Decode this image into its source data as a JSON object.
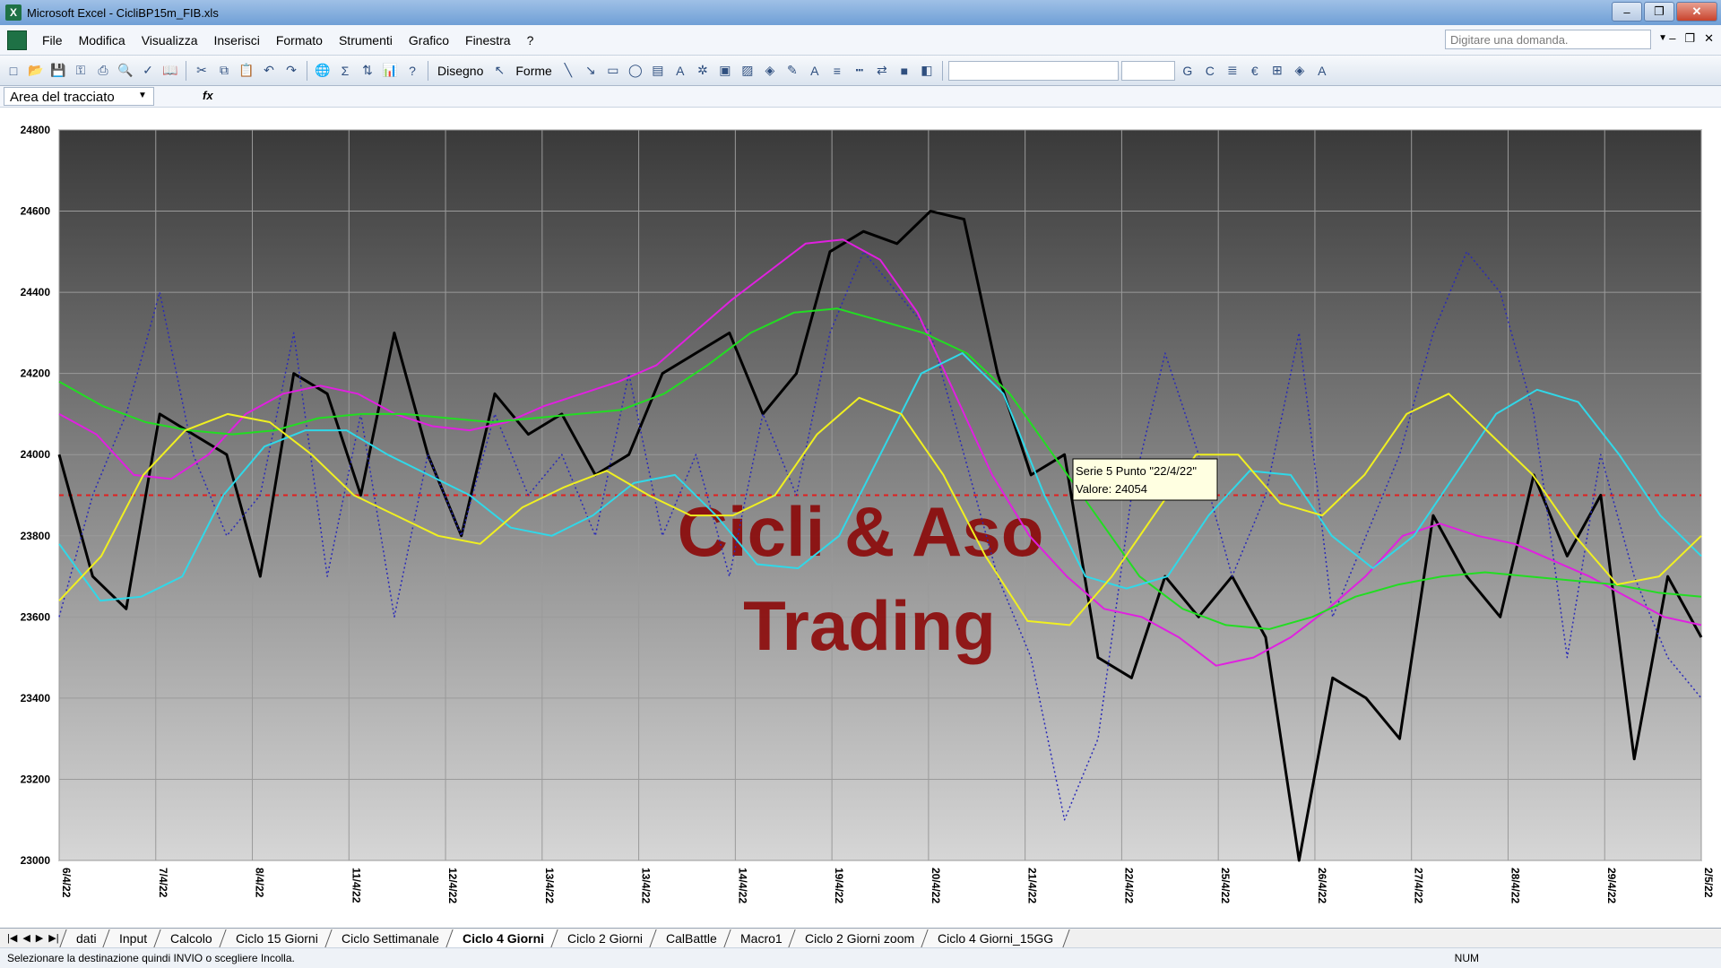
{
  "window": {
    "title": "Microsoft Excel - CicliBP15m_FIB.xls"
  },
  "menu": {
    "items": [
      "File",
      "Modifica",
      "Visualizza",
      "Inserisci",
      "Formato",
      "Strumenti",
      "Grafico",
      "Finestra",
      "?"
    ],
    "ask_placeholder": "Digitare una domanda."
  },
  "toolbar": {
    "disegno_label": "Disegno",
    "forme_label": "Forme"
  },
  "namebox": {
    "value": "Area del tracciato"
  },
  "sheet_tabs": {
    "items": [
      "dati",
      "Input",
      "Calcolo",
      "Ciclo 15 Giorni",
      "Ciclo Settimanale",
      "Ciclo 4 Giorni",
      "Ciclo 2 Giorni",
      "CalBattle",
      "Macro1",
      "Ciclo 2 Giorni zoom",
      "Ciclo 4 Giorni_15GG"
    ],
    "active": "Ciclo 4 Giorni"
  },
  "status": {
    "message": "Selezionare la destinazione quindi INVIO o scegliere Incolla.",
    "num": "NUM"
  },
  "chart_data": {
    "type": "line",
    "ylim": [
      23000,
      24800
    ],
    "yticks": [
      23000,
      23200,
      23400,
      23600,
      23800,
      24000,
      24200,
      24400,
      24600,
      24800
    ],
    "categories": [
      "6/4/22",
      "7/4/22",
      "8/4/22",
      "11/4/22",
      "12/4/22",
      "13/4/22",
      "13/4/22",
      "14/4/22",
      "19/4/22",
      "20/4/22",
      "21/4/22",
      "22/4/22",
      "25/4/22",
      "26/4/22",
      "27/4/22",
      "28/4/22",
      "29/4/22",
      "2/5/22"
    ],
    "reference_line": 23900,
    "watermark": [
      "Cicli & Aso",
      "Trading"
    ],
    "tooltip": {
      "line1": "Serie 5 Punto \"22/4/22\"",
      "line2": "Valore: 24054"
    },
    "colors": {
      "price": "#000000",
      "dotted": "#2a2ab8",
      "magenta": "#e020e0",
      "green": "#22dd22",
      "cyan": "#30d8e8",
      "yellow": "#f0f020",
      "reference": "#e02020",
      "watermark": "#8b0000"
    },
    "series": [
      {
        "color": "#000000",
        "values": [
          24000,
          23700,
          23620,
          24100,
          24050,
          24000,
          23700,
          24200,
          24150,
          23900,
          24300,
          24000,
          23800,
          24150,
          24050,
          24100,
          23950,
          24000,
          24200,
          24250,
          24300,
          24100,
          24200,
          24500,
          24550,
          24520,
          24600,
          24580,
          24200,
          23950,
          24000,
          23500,
          23450,
          23700,
          23600,
          23700,
          23550,
          23000,
          23450,
          23400,
          23300,
          23850,
          23700,
          23600,
          23950,
          23750,
          23900,
          23250,
          23700,
          23550
        ]
      },
      {
        "color": "#2a2ab8",
        "values": [
          23600,
          23900,
          24100,
          24400,
          24000,
          23800,
          23900,
          24300,
          23700,
          24100,
          23600,
          24000,
          23800,
          24100,
          23900,
          24000,
          23800,
          24200,
          23800,
          24000,
          23700,
          24100,
          23900,
          24300,
          24500,
          24400,
          24300,
          24000,
          23700,
          23500,
          23100,
          23300,
          23900,
          24250,
          24000,
          23700,
          23900,
          24300,
          23600,
          23800,
          24000,
          24300,
          24500,
          24400,
          24100,
          23500,
          24000,
          23700,
          23500,
          23400
        ]
      },
      {
        "color": "#e020e0",
        "values": [
          24100,
          24050,
          23950,
          23940,
          24000,
          24100,
          24150,
          24170,
          24150,
          24100,
          24070,
          24060,
          24080,
          24120,
          24150,
          24180,
          24220,
          24300,
          24380,
          24450,
          24520,
          24530,
          24480,
          24350,
          24150,
          23950,
          23800,
          23700,
          23620,
          23600,
          23550,
          23480,
          23500,
          23550,
          23620,
          23700,
          23800,
          23830,
          23800,
          23780,
          23740,
          23700,
          23650,
          23600,
          23580
        ]
      },
      {
        "color": "#22dd22",
        "values": [
          24180,
          24120,
          24080,
          24060,
          24050,
          24060,
          24090,
          24100,
          24100,
          24090,
          24080,
          24090,
          24100,
          24110,
          24150,
          24220,
          24300,
          24350,
          24360,
          24330,
          24300,
          24250,
          24150,
          24000,
          23850,
          23700,
          23620,
          23580,
          23570,
          23600,
          23650,
          23680,
          23700,
          23710,
          23700,
          23690,
          23680,
          23660,
          23650
        ]
      },
      {
        "color": "#30d8e8",
        "values": [
          23780,
          23640,
          23650,
          23700,
          23900,
          24020,
          24060,
          24060,
          24000,
          23950,
          23900,
          23820,
          23800,
          23850,
          23930,
          23950,
          23850,
          23730,
          23720,
          23800,
          24000,
          24200,
          24250,
          24150,
          23900,
          23700,
          23670,
          23700,
          23850,
          23960,
          23950,
          23800,
          23720,
          23800,
          23950,
          24100,
          24160,
          24130,
          24000,
          23850,
          23750
        ]
      },
      {
        "color": "#f0f020",
        "values": [
          23640,
          23750,
          23950,
          24060,
          24100,
          24080,
          24000,
          23900,
          23850,
          23800,
          23780,
          23870,
          23920,
          23960,
          23900,
          23850,
          23850,
          23900,
          24050,
          24140,
          24100,
          23950,
          23750,
          23590,
          23580,
          23700,
          23850,
          24000,
          24000,
          23880,
          23850,
          23950,
          24100,
          24150,
          24050,
          23950,
          23800,
          23680,
          23700,
          23800
        ]
      }
    ]
  }
}
